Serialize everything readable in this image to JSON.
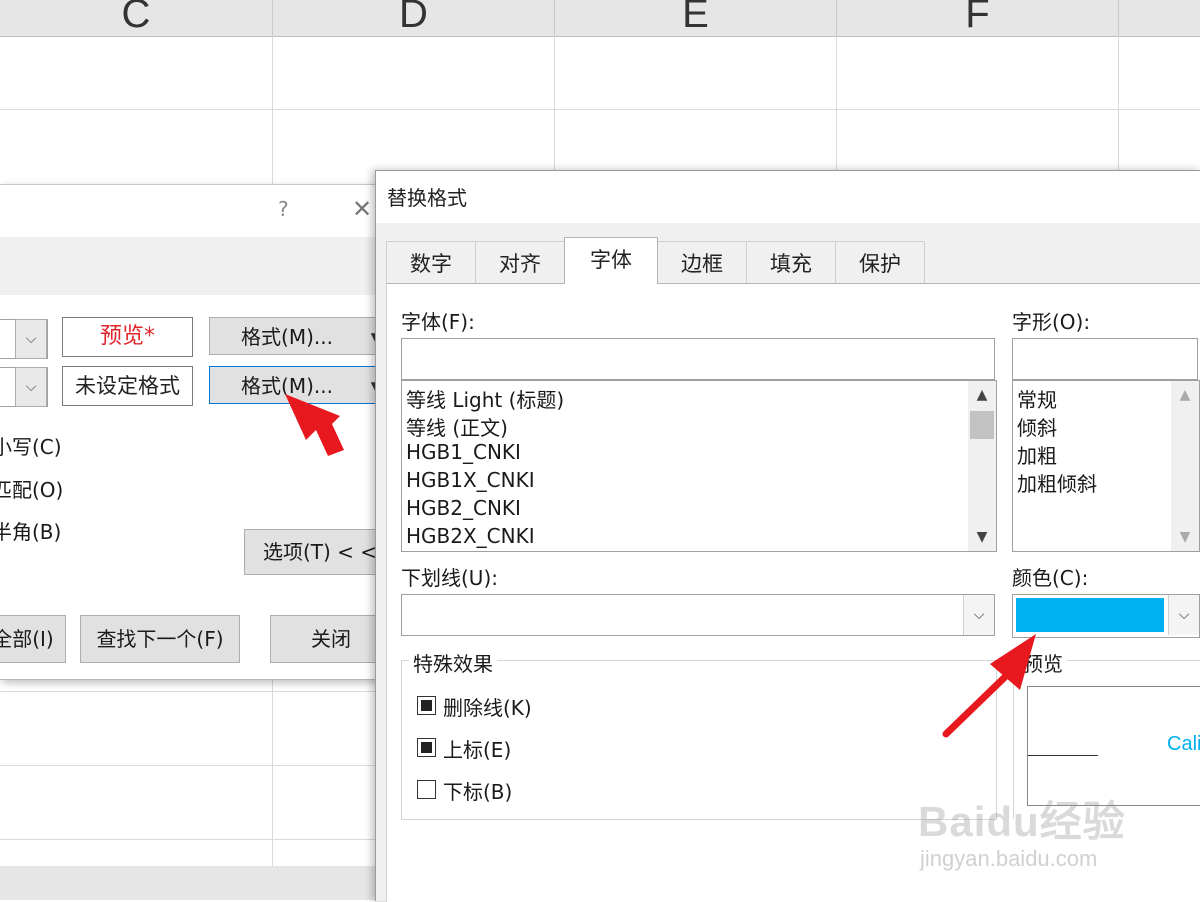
{
  "spreadsheet": {
    "columns": [
      "C",
      "D",
      "E",
      "F"
    ]
  },
  "find_replace": {
    "title_help": "?",
    "title_close": "✕",
    "find_preview_label": "预览*",
    "replace_preview_label": "未设定格式",
    "format_button_1": "格式(M)...",
    "format_button_2": "格式(M)...",
    "option_match_case": "小写(C)",
    "option_whole_cell": "匹配(O)",
    "option_byte_width": "半角(B)",
    "options_button": "选项(T) < <",
    "find_all_button": "全部(I)",
    "find_next_button": "查找下一个(F)",
    "close_button": "关闭"
  },
  "replace_format": {
    "title": "替换格式",
    "tabs": [
      "数字",
      "对齐",
      "字体",
      "边框",
      "填充",
      "保护"
    ],
    "active_tab": "字体",
    "font_label": "字体(F):",
    "font_input_value": "",
    "font_list": [
      "等线 Light (标题)",
      "等线 (正文)",
      "HGB1_CNKI",
      "HGB1X_CNKI",
      "HGB2_CNKI",
      "HGB2X_CNKI"
    ],
    "style_label": "字形(O):",
    "style_input_value": "",
    "style_list": [
      "常规",
      "倾斜",
      "加粗",
      "加粗倾斜"
    ],
    "underline_label": "下划线(U):",
    "underline_value": "",
    "color_label": "颜色(C):",
    "color_value": "#00b0f0",
    "effects_group_label": "特殊效果",
    "effects": [
      {
        "label": "删除线(K)",
        "checked": true
      },
      {
        "label": "上标(E)",
        "checked": true
      },
      {
        "label": "下标(B)",
        "checked": false
      }
    ],
    "preview_label": "预览",
    "preview_sample": "Cali"
  },
  "watermark": {
    "brand": "Baidu经验",
    "url": "jingyan.baidu.com"
  },
  "annotation_color": "#e8191e"
}
